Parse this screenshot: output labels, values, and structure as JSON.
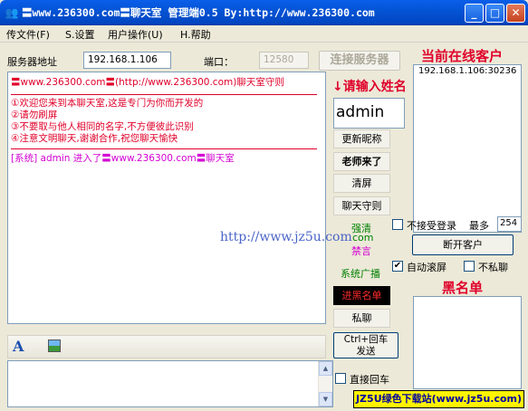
{
  "window": {
    "app_icon": "chat-app-icon",
    "title": "〓www.236300.com〓聊天室 管理端0.5  By:http://www.236300.com",
    "minimize": "_",
    "maximize": "□",
    "close": "✕"
  },
  "menu": {
    "items": [
      {
        "label": "传文件(F)"
      },
      {
        "label": "S.设置"
      },
      {
        "label": "用户操作(U)"
      },
      {
        "label": "H.帮助"
      }
    ]
  },
  "server": {
    "address_label": "服务器地址",
    "address_value": "192.168.1.106",
    "port_label": "端口：",
    "port_value": "12580",
    "connect_button": "连接服务器"
  },
  "chat": {
    "lines": [
      {
        "text": "〓www.236300.com〓(http://www.236300.com)聊天室守则",
        "color": "#E0002A"
      },
      {
        "text": "①欢迎您来到本聊天室,这是专门为你而开发的",
        "color": "#E0002A"
      },
      {
        "text": "②请勿刷屏",
        "color": "#E0002A"
      },
      {
        "text": "③不要取与他人相同的名字,不方便彼此识别",
        "color": "#E0002A"
      },
      {
        "text": "④注意文明聊天,谢谢合作,祝您聊天愉快",
        "color": "#E0002A"
      },
      {
        "text": "[系统] admin 进入了〓www.236300.com〓聊天室",
        "color": "#D400D4"
      }
    ]
  },
  "name": {
    "prompt": "↓请输入姓名",
    "value": "admin"
  },
  "side_buttons": {
    "rename": "更新昵称",
    "teacher": "老师来了",
    "clear": "清屏",
    "rules": "聊天守则",
    "broadcast": "系统广播",
    "blacklist": "进黑名单",
    "private": "私聊",
    "send": "Ctrl+回车\n发送"
  },
  "side_links": {
    "force_clear": "强清",
    "com": "com",
    "mute": "禁言"
  },
  "clients": {
    "heading": "当前在线客户",
    "items": [
      "192.168.1.106:30236"
    ],
    "reject_login": "不接受登录",
    "max_label": "最多",
    "max_value": "254",
    "disconnect": "断开客户",
    "autoscroll": "自动滚屏",
    "autoscroll_checked": true,
    "no_private": "不私聊",
    "no_private_checked": false
  },
  "blacklist": {
    "heading": "黑名单"
  },
  "input": {
    "enter_send": "直接回车",
    "enter_send_checked": false
  },
  "watermark": "http://www.jz5u.com",
  "footer": "JZ5U绿色下载站(www.jz5u.com)",
  "colors": {
    "titlebar": "#0454D6",
    "accent_red": "#E0002A",
    "system_magenta": "#D400D4",
    "green": "#008000",
    "watermark_blue": "#4A64C8"
  }
}
